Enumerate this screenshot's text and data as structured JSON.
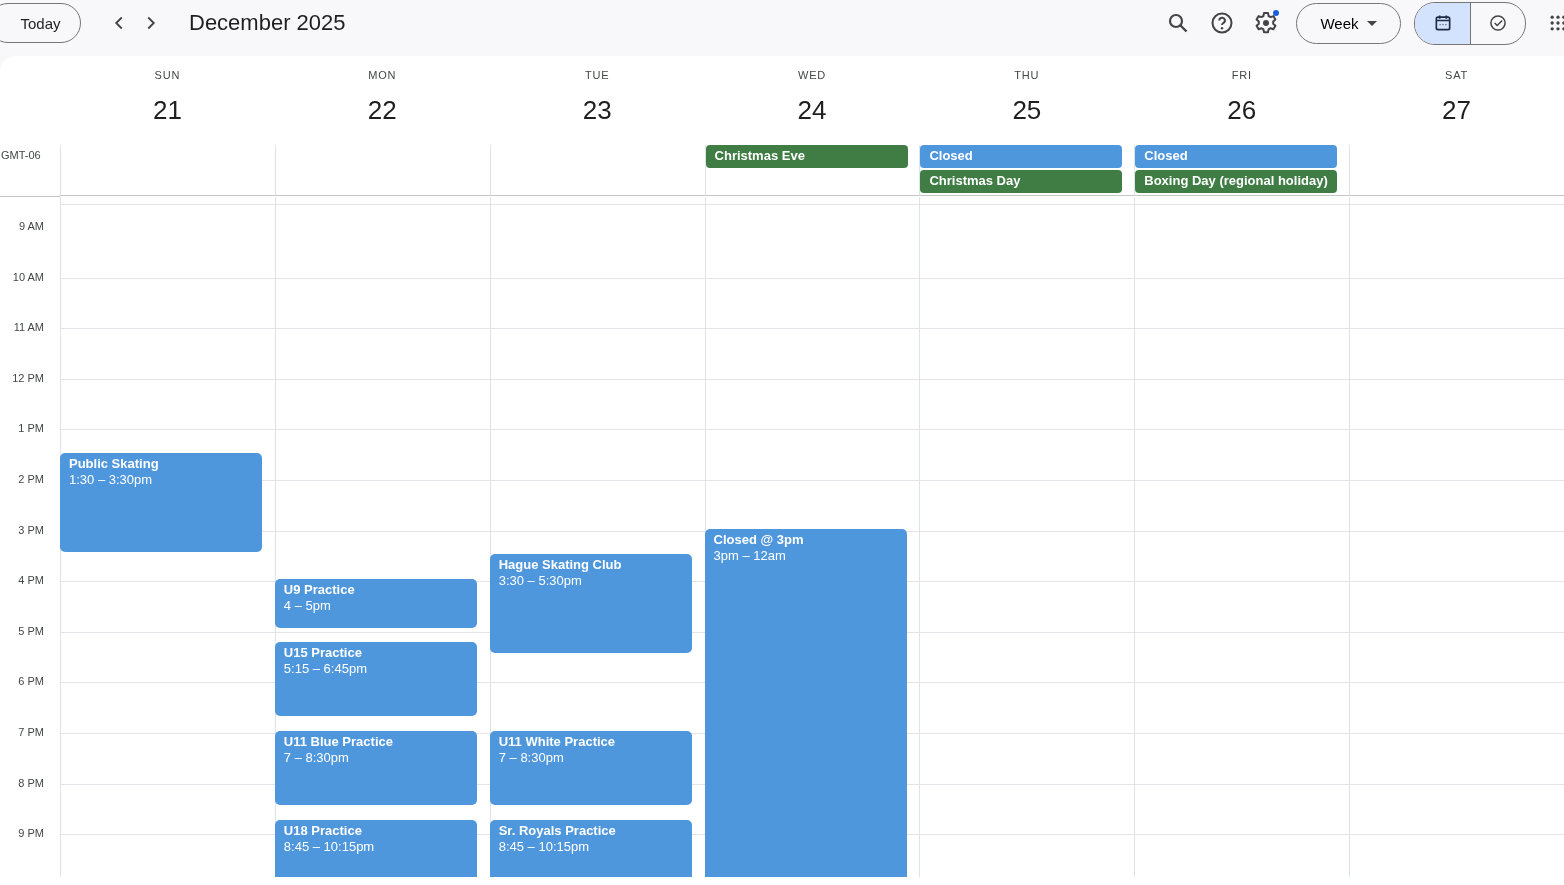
{
  "toolbar": {
    "today_button": "Today",
    "title": "December 2025",
    "view_button": "Week",
    "settings_badge": true,
    "view_toggle": [
      {
        "kind": "calendar",
        "selected": true
      },
      {
        "kind": "tasks",
        "selected": false
      }
    ]
  },
  "timezone": "GMT-06",
  "hours": [
    "9 AM",
    "10 AM",
    "11 AM",
    "12 PM",
    "1 PM",
    "2 PM",
    "3 PM",
    "4 PM",
    "5 PM",
    "6 PM",
    "7 PM",
    "8 PM",
    "9 PM"
  ],
  "days": [
    {
      "weekday": "SUN",
      "date": "21",
      "events": [
        {
          "title": "Public Skating",
          "time": "1:30 – 3:30pm"
        }
      ]
    },
    {
      "weekday": "MON",
      "date": "22",
      "events": [
        {
          "title": "U9 Practice",
          "time": "4 – 5pm"
        },
        {
          "title": "U15 Practice",
          "time": "5:15 – 6:45pm"
        },
        {
          "title": "U11 Blue Practice",
          "time": "7 – 8:30pm"
        },
        {
          "title": "U18 Practice",
          "time": "8:45 – 10:15pm"
        }
      ]
    },
    {
      "weekday": "TUE",
      "date": "23",
      "events": [
        {
          "title": "Hague Skating Club",
          "time": "3:30 – 5:30pm"
        },
        {
          "title": "U11 White Practice",
          "time": "7 – 8:30pm"
        },
        {
          "title": "Sr. Royals Practice",
          "time": "8:45 – 10:15pm"
        }
      ]
    },
    {
      "weekday": "WED",
      "date": "24",
      "all_day": [
        {
          "title": "Christmas Eve",
          "color": "#3f7d45"
        }
      ],
      "events": [
        {
          "title": "Closed @ 3pm",
          "time": "3pm – 12am"
        }
      ]
    },
    {
      "weekday": "THU",
      "date": "25",
      "all_day": [
        {
          "title": "Closed",
          "color": "#4f97dc"
        },
        {
          "title": "Christmas Day",
          "color": "#3f7d45"
        }
      ]
    },
    {
      "weekday": "FRI",
      "date": "26",
      "all_day": [
        {
          "title": "Closed",
          "color": "#4f97dc"
        },
        {
          "title": "Boxing Day (regional holiday)",
          "color": "#3f7d45"
        }
      ]
    },
    {
      "weekday": "SAT",
      "date": "27"
    }
  ]
}
